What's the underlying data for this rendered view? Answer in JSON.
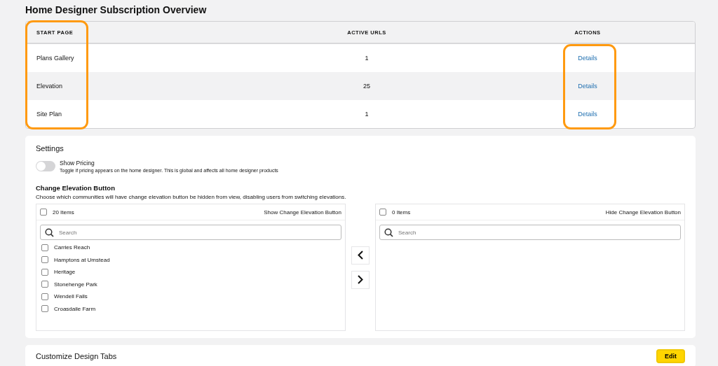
{
  "page": {
    "title": "Home Designer Subscription Overview"
  },
  "table": {
    "columns": [
      {
        "label": "START PAGE",
        "highlighted": true
      },
      {
        "label": "ACTIVE URLS",
        "highlighted": false
      },
      {
        "label": "ACTIONS",
        "highlighted": true
      }
    ],
    "rows": [
      {
        "start_page": "Plans Gallery",
        "active_urls": "1",
        "action": "Details"
      },
      {
        "start_page": "Elevation",
        "active_urls": "25",
        "action": "Details"
      },
      {
        "start_page": "Site Plan",
        "active_urls": "1",
        "action": "Details"
      }
    ]
  },
  "settings": {
    "title": "Settings",
    "toggle": {
      "label": "Show Pricing",
      "description": "Toggle if pricing appears on the home designer. This is global and affects all home designer products",
      "on": false
    },
    "change_elevation": {
      "title": "Change Elevation Button",
      "description": "Choose which communities will have change elevation button be hidden from view, disabling users from switching elevations.",
      "lists": [
        {
          "count": "20 Items",
          "title": "Show Change Elevation Button",
          "checked": false,
          "placeholder": "Search",
          "items": [
            {
              "label": "Carries Reach",
              "checked": false
            },
            {
              "label": "Hamptons at Umstead",
              "checked": false
            },
            {
              "label": "Heritage",
              "checked": false
            },
            {
              "label": "Stonehenge Park",
              "checked": false
            },
            {
              "label": "Wendell Falls",
              "checked": false
            },
            {
              "label": "Croasdaile Farm",
              "checked": false
            }
          ]
        },
        {
          "count": "0 Items",
          "title": "Hide Change Elevation Button",
          "checked": false,
          "placeholder": "Search"
        }
      ]
    }
  },
  "customize": {
    "title": "Customize Design Tabs",
    "button": "Edit"
  }
}
